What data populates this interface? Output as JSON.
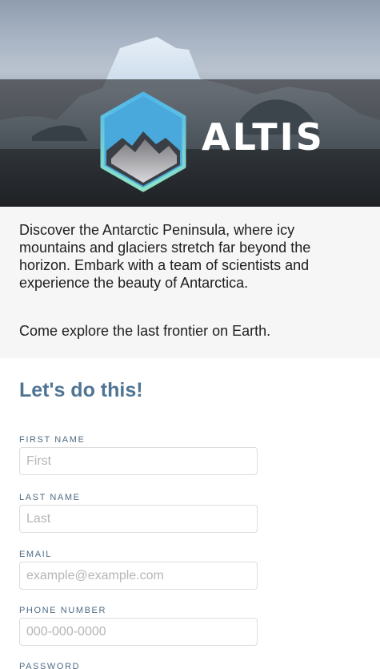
{
  "brand": {
    "name": "ALTIS",
    "logo_icon": "mountain-hexagon-icon",
    "colors": {
      "gradient_top": "#4fb6ea",
      "gradient_bottom": "#8fe3c4",
      "band": "#28282a"
    }
  },
  "intro": {
    "description": "Discover the Antarctic Peninsula, where icy mountains and glaciers stretch far beyond the horizon. Embark with a team of scientists and experience the beauty of Antarctica.",
    "cta": "Come explore the last frontier on Earth."
  },
  "form": {
    "heading": "Let's do this!",
    "accent_color": "#4f7494",
    "fields": [
      {
        "label": "FIRST NAME",
        "placeholder": "First",
        "value": ""
      },
      {
        "label": "LAST NAME",
        "placeholder": "Last",
        "value": ""
      },
      {
        "label": "EMAIL",
        "placeholder": "example@example.com",
        "value": ""
      },
      {
        "label": "PHONE NUMBER",
        "placeholder": "000-000-0000",
        "value": ""
      },
      {
        "label": "PASSWORD",
        "placeholder": "",
        "value": ""
      }
    ]
  }
}
